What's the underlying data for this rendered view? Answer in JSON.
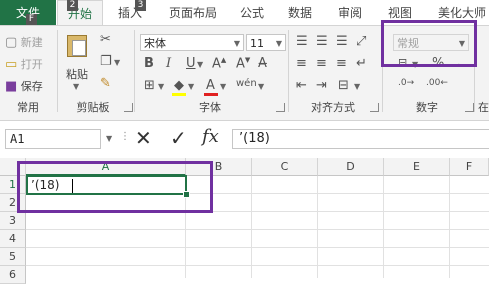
{
  "tabs": [
    {
      "label": "文件",
      "keytip": "F"
    },
    {
      "label": "开始",
      "keytip": "2"
    },
    {
      "label": "插入",
      "keytip": "3"
    },
    {
      "label": "页面布局",
      "keytip": ""
    },
    {
      "label": "公式",
      "keytip": ""
    },
    {
      "label": "数据",
      "keytip": ""
    },
    {
      "label": "审阅",
      "keytip": ""
    },
    {
      "label": "视图",
      "keytip": ""
    },
    {
      "label": "美化大师",
      "keytip": ""
    }
  ],
  "ribbon": {
    "common": {
      "new": "新建",
      "open": "打开",
      "save": "保存",
      "group": "常用"
    },
    "clipboard": {
      "paste": "粘贴",
      "group": "剪贴板"
    },
    "font": {
      "name": "宋体",
      "size": "11",
      "bold": "B",
      "italic": "I",
      "underline": "U",
      "font_color": "A",
      "group": "字体"
    },
    "alignment": {
      "group": "对齐方式"
    },
    "number": {
      "format": "常规",
      "percent": "%",
      "group": "数字"
    },
    "partial_group": "在"
  },
  "formula_bar": {
    "name_box": "A1",
    "cancel": "✕",
    "enter": "✓",
    "fx": "fx",
    "content": "’(18)"
  },
  "grid": {
    "columns": [
      "A",
      "B",
      "C",
      "D",
      "E",
      "F"
    ],
    "rows": [
      "1",
      "2",
      "3",
      "4",
      "5",
      "6"
    ],
    "a1_value": "’(18)"
  },
  "colors": {
    "accent": "#217346",
    "highlight": "#7030a0",
    "selection": "#217346"
  }
}
